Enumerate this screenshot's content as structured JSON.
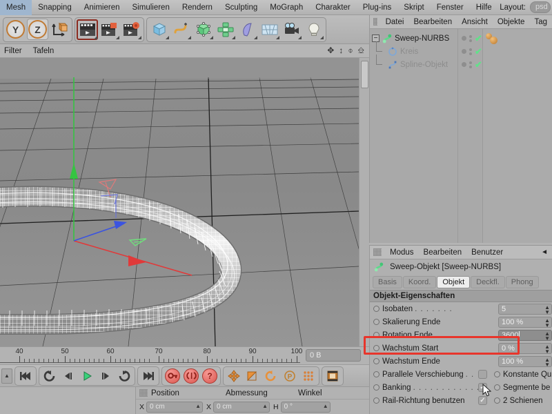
{
  "menubar": {
    "items": [
      "Mesh",
      "Snapping",
      "Animieren",
      "Simulieren",
      "Rendern",
      "Sculpting",
      "MoGraph",
      "Charakter",
      "Plug-ins",
      "Skript",
      "Fenster",
      "Hilfe"
    ],
    "layout_label": "Layout:",
    "layout_value": "psd"
  },
  "toolbar": {
    "axis_y": "Y",
    "axis_z": "Z",
    "icons": [
      "axis-world-icon",
      "render-view-icon",
      "render-picture-viewer-icon",
      "render-settings-icon",
      "cube-icon",
      "spline-icon",
      "nurbs-icon",
      "array-icon",
      "deformer-icon",
      "scene-icon",
      "camera-icon",
      "light-icon"
    ]
  },
  "filterbar": {
    "filter": "Filter",
    "panels": "Tafeln"
  },
  "object_manager": {
    "menu": [
      "Datei",
      "Bearbeiten",
      "Ansicht",
      "Objekte",
      "Tag"
    ],
    "rows": [
      {
        "label": "Sweep-NURBS",
        "dim": false,
        "depth": 0,
        "expanded": true,
        "icon": "sweep-nurbs-icon",
        "tag": "material-tag"
      },
      {
        "label": "Kreis",
        "dim": true,
        "depth": 1,
        "expanded": false,
        "icon": "circle-spline-icon",
        "tag": ""
      },
      {
        "label": "Spline-Objekt",
        "dim": true,
        "depth": 1,
        "expanded": false,
        "icon": "spline-object-icon",
        "tag": ""
      }
    ]
  },
  "attribute_manager": {
    "menu": [
      "Modus",
      "Bearbeiten",
      "Benutzer"
    ],
    "object_title": "Sweep-Objekt [Sweep-NURBS]",
    "tabs": [
      {
        "label": "Basis",
        "active": false
      },
      {
        "label": "Koord.",
        "active": false
      },
      {
        "label": "Objekt",
        "active": true
      },
      {
        "label": "Deckfl.",
        "active": false
      },
      {
        "label": "Phong",
        "active": false
      }
    ],
    "section_title": "Objekt-Eigenschaften",
    "fields": [
      {
        "label": "Isobaten",
        "dots": ". . . . . . .",
        "value": "5",
        "editing": false
      },
      {
        "label": "Skalierung Ende",
        "dots": "",
        "value": "100 %",
        "editing": false
      },
      {
        "label": "Rotation Ende",
        "dots": ". .",
        "value": "3600",
        "editing": true
      },
      {
        "label": "Wachstum Start",
        "dots": "",
        "value": "0 %",
        "editing": false
      },
      {
        "label": "Wachstum Ende",
        "dots": "",
        "value": "100 %",
        "editing": false
      }
    ],
    "checkbox_rows": [
      {
        "left_label": "Parallele Verschiebung",
        "left_dots": ". .",
        "left_checked": false,
        "right_label": "Konstante Qu",
        "right_checked": false
      },
      {
        "left_label": "Banking",
        "left_dots": ". . . . . . . . . . . . . .",
        "left_checked": true,
        "right_label": "Segmente be",
        "right_checked": false
      },
      {
        "left_label": "Rail-Richtung benutzen",
        "left_dots": "",
        "left_checked": true,
        "right_label": "2 Schienen",
        "right_checked": false
      }
    ]
  },
  "timeline": {
    "ticks": [
      "40",
      "50",
      "60",
      "70",
      "80",
      "90",
      "100"
    ],
    "frame_field": "0 B"
  },
  "transport": {
    "buttons": [
      "go-to-start-icon",
      "play-reverse-loop-icon",
      "step-back-icon",
      "play-icon",
      "step-forward-icon",
      "loop-icon",
      "go-to-end-icon"
    ],
    "record_buttons": [
      "record-key-icon",
      "autokey-icon",
      "key-selection-icon"
    ],
    "toggle_buttons": [
      "position-key-icon",
      "scale-key-icon",
      "rotation-key-icon",
      "parameter-key-icon",
      "point-level-key-icon"
    ],
    "extra": "timeline-icon"
  },
  "coordinates": {
    "headers": [
      "Position",
      "Abmessung",
      "Winkel"
    ],
    "rows": [
      {
        "axis": "X",
        "position": "0 cm",
        "axis2": "X",
        "size": "0 cm",
        "axis3": "H",
        "angle": "0 °"
      }
    ]
  },
  "viewport": {
    "object_name": "sweep-nurbs-mesh",
    "gizmo_axes": [
      "x-axis-red",
      "y-axis-green",
      "z-axis-blue"
    ],
    "grid": "ground-grid"
  },
  "colors": {
    "accent_red": "#e8352b",
    "panel_bg": "#b0b0b0",
    "toolbar_bg": "#bdbdbd",
    "viewport_bg": "#8f8f8f",
    "green_check": "#63e08a",
    "play_green": "#3ad17a"
  }
}
